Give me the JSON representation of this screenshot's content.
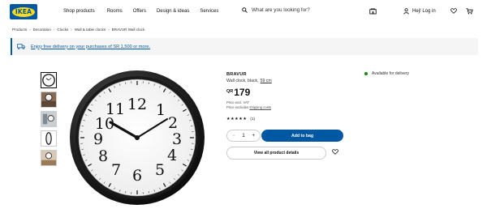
{
  "header": {
    "logo_text": "IKEA",
    "nav": [
      "Shop products",
      "Rooms",
      "Offers",
      "Design & ideas",
      "Services"
    ],
    "search_placeholder": "What are you looking for?",
    "login_label": "Hej! Log in",
    "brand_color": "#0058a3",
    "logo_yellow": "#ffda1a"
  },
  "breadcrumb": [
    "Products",
    "Decoration",
    "Clocks",
    "Wall & table clocks",
    "BRAVUR Wall clock"
  ],
  "banner": {
    "text": "Enjoy free delivery on your purchases of SR 1,500 or more.",
    "icon": "truck-icon"
  },
  "thumbnails": [
    "clock-front",
    "clock-kitchen",
    "clock-wall",
    "clock-side",
    "clock-room"
  ],
  "product": {
    "name": "BRAVUR",
    "description": "Wall clock, black,",
    "measurement": "59 cm",
    "currency": "QR",
    "price": "179",
    "vat_note": "Price excl. VAT",
    "shipping_prefix": "Price excludes",
    "shipping_link": "shipping costs",
    "rating_stars": "★★★★★",
    "review_count": "(1)",
    "quantity": "1",
    "qty_minus": "−",
    "qty_plus": "+",
    "add_to_bag": "Add to bag",
    "view_details": "View all product details",
    "availability": "Available for delivery",
    "availability_color": "#0a8a00"
  }
}
